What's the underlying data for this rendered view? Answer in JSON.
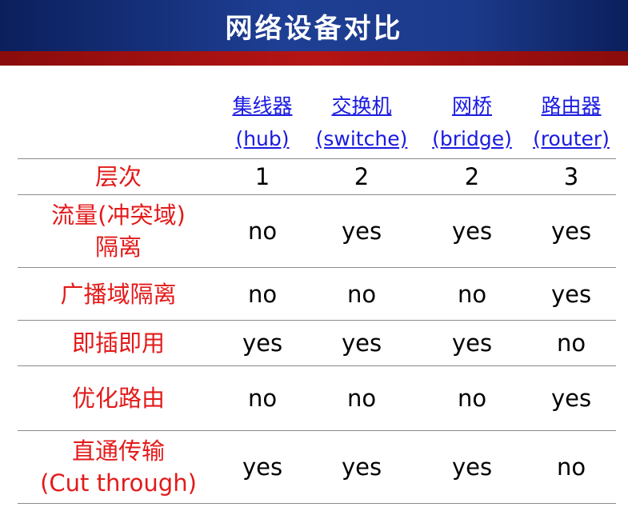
{
  "title": "网络设备对比",
  "columns": [
    {
      "name": "集线器",
      "english": "(hub)"
    },
    {
      "name": "交换机",
      "english": "(switche)"
    },
    {
      "name": "网桥",
      "english": "(bridge)"
    },
    {
      "name": "路由器",
      "english": "(router)"
    }
  ],
  "rows": [
    {
      "label_line1": "层次",
      "label_line2": "",
      "values": [
        "1",
        "2",
        "2",
        "3"
      ]
    },
    {
      "label_line1": "流量(冲突域)",
      "label_line2": "隔离",
      "values": [
        "no",
        "yes",
        "yes",
        "yes"
      ]
    },
    {
      "label_line1": "广播域隔离",
      "label_line2": "",
      "values": [
        "no",
        "no",
        "no",
        "yes"
      ]
    },
    {
      "label_line1": "即插即用",
      "label_line2": "",
      "values": [
        "yes",
        "yes",
        "yes",
        "no"
      ]
    },
    {
      "label_line1": "优化路由",
      "label_line2": "",
      "values": [
        "no",
        "no",
        "no",
        "yes"
      ]
    },
    {
      "label_line1": "直通传输",
      "label_line2": "(Cut through)",
      "values": [
        "yes",
        "yes",
        "yes",
        "no"
      ]
    }
  ],
  "colors": {
    "title_bar": "#1e3f94",
    "accent_bar": "#b51414",
    "header_link": "#1a1ae0",
    "row_label": "#e31a1a"
  }
}
